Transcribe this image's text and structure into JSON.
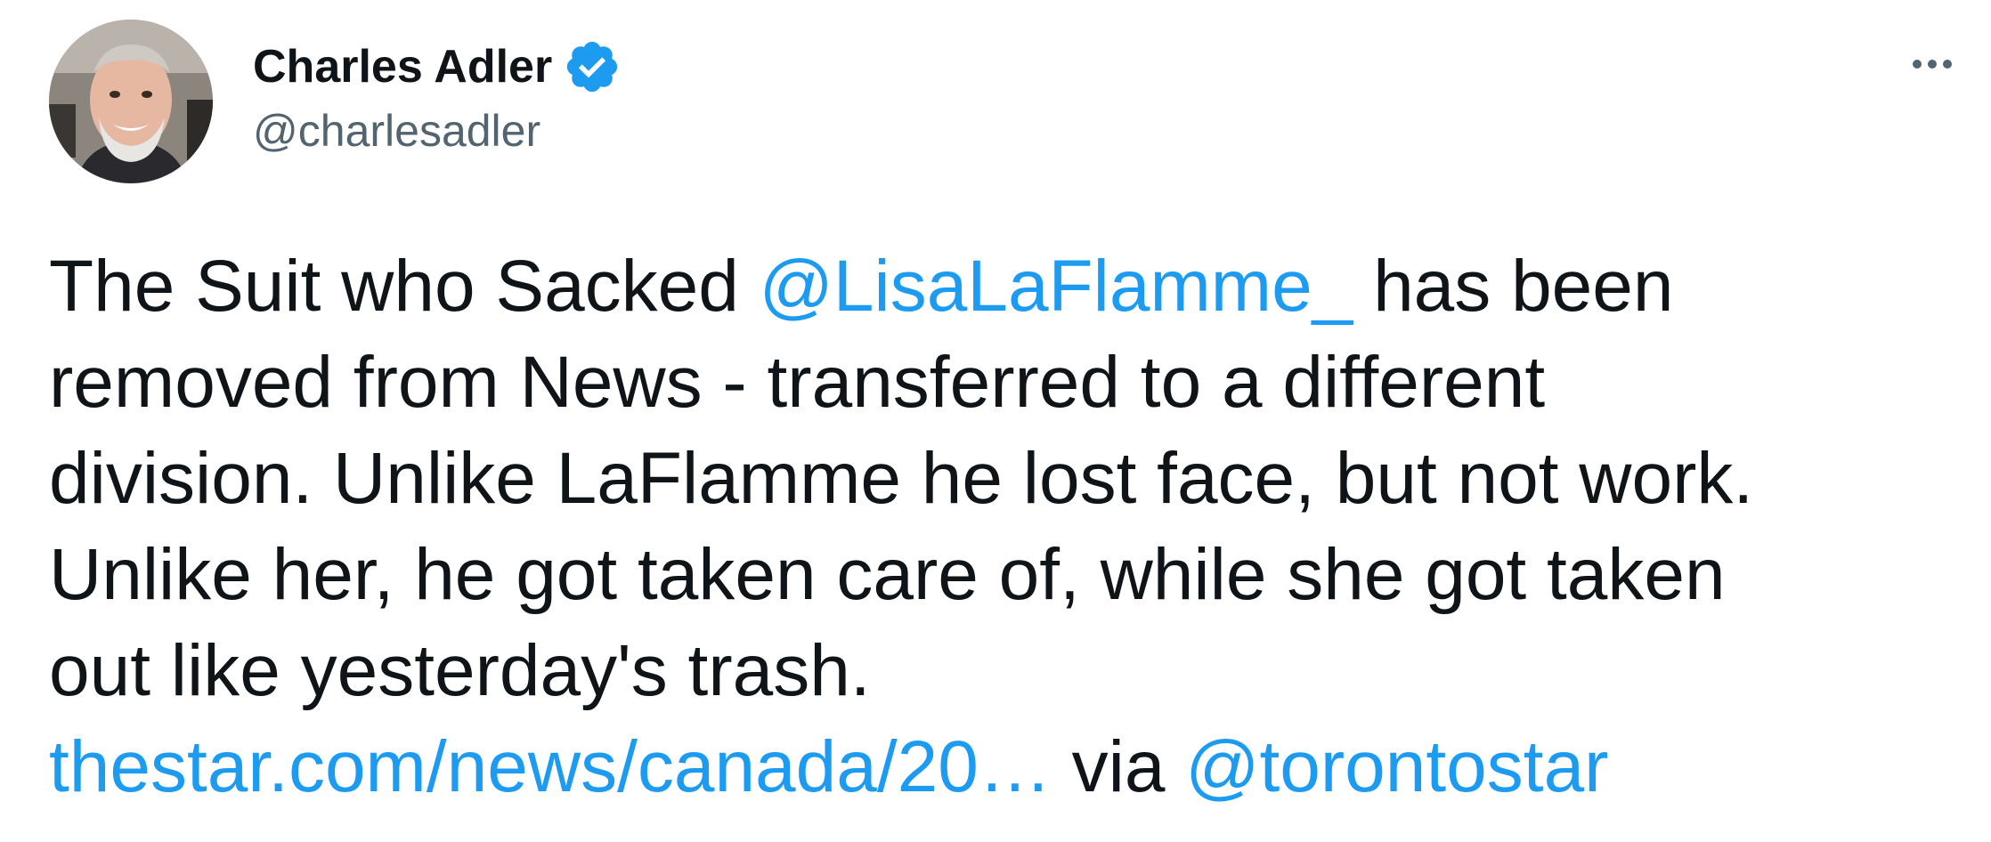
{
  "author": {
    "display_name": "Charles Adler",
    "handle": "@charlesadler",
    "verified_icon": "verified-badge-icon",
    "avatar_icon": "profile-photo"
  },
  "menu": {
    "icon": "more-options-icon"
  },
  "tweet": {
    "line1_pre": "The Suit who Sacked ",
    "mention1": "@LisaLaFlamme_",
    "line1_post": " has been",
    "line2": "removed from News - transferred to a different",
    "line3": "division. Unlike LaFlamme he lost face, but not work.",
    "line4": "Unlike her, he got taken care of, while she got taken",
    "line5": "out like yesterday's trash.",
    "link_text": "thestar.com/news/canada/20…",
    "via_text": " via ",
    "mention2": "@torontostar"
  },
  "colors": {
    "accent": "#1d9bf0",
    "text": "#0f1419",
    "secondary": "#536471"
  }
}
